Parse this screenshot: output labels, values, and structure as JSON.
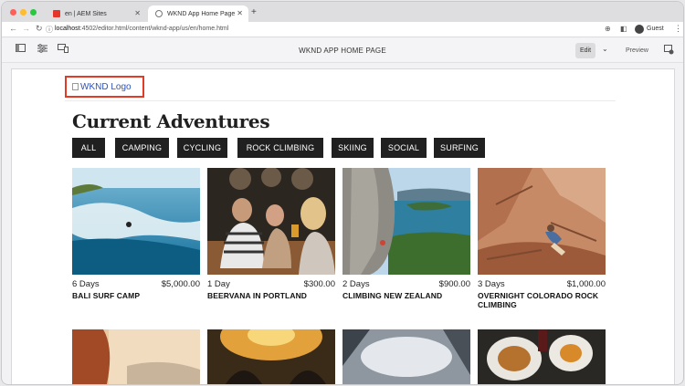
{
  "browser": {
    "tabs": [
      {
        "label": "en | AEM Sites",
        "active": false
      },
      {
        "label": "WKND App Home Page",
        "active": true
      }
    ],
    "new_tab": "+",
    "url_host": "localhost",
    "url_path": ":4502/editor.html/content/wknd-app/us/en/home.html",
    "profile_label": "Guest"
  },
  "editor": {
    "title": "WKND APP HOME PAGE",
    "edit_label": "Edit",
    "preview_label": "Preview"
  },
  "page": {
    "logo_alt": "WKND Logo",
    "heading": "Current Adventures",
    "filters": [
      "ALL",
      "CAMPING",
      "CYCLING",
      "ROCK CLIMBING",
      "SKIING",
      "SOCIAL",
      "SURFING"
    ],
    "cards": [
      {
        "days": "6 Days",
        "price": "$5,000.00",
        "title": "BALI SURF CAMP",
        "image": "surfer-wave"
      },
      {
        "days": "1 Day",
        "price": "$300.00",
        "title": "BEERVANA IN PORTLAND",
        "image": "people-drinking-beer"
      },
      {
        "days": "2 Days",
        "price": "$900.00",
        "title": "CLIMBING NEW ZEALAND",
        "image": "climber-cliff-sea"
      },
      {
        "days": "3 Days",
        "price": "$1,000.00",
        "title": "OVERNIGHT COLORADO ROCK CLIMBING",
        "image": "climber-red-rock"
      }
    ],
    "second_row_images": [
      "red-cliff-sky",
      "cyclists-sunset",
      "mountain-clouds",
      "food-plates"
    ]
  },
  "colors": {
    "logo_outline": "#e23c28",
    "filter_bg": "#202020",
    "filter_text": "#ffffff",
    "link": "#2a52be"
  }
}
